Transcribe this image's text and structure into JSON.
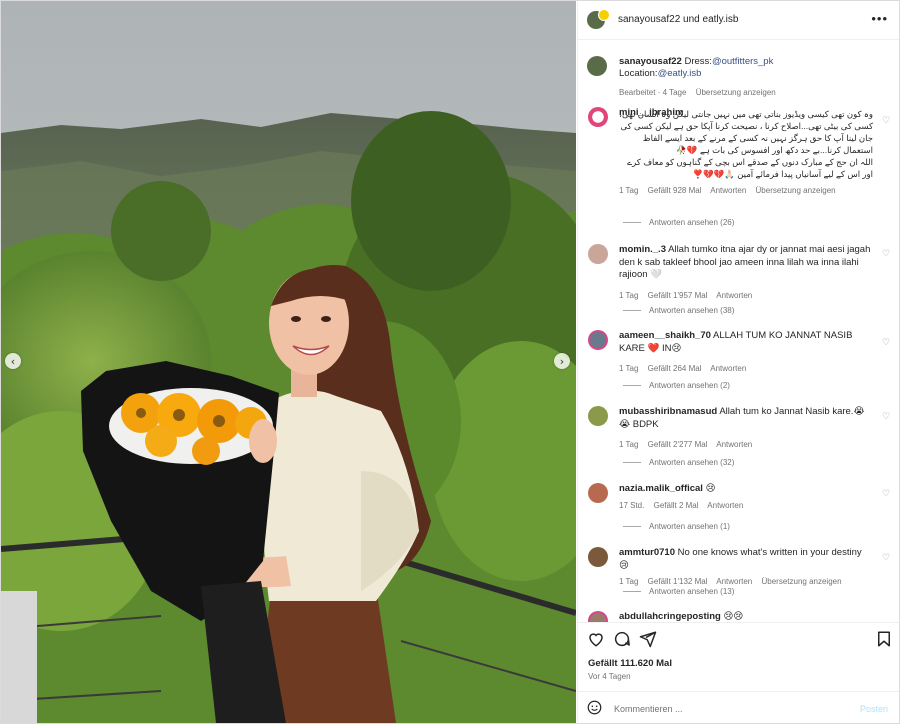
{
  "post": {
    "header_title": "sanayousaf22 und eatly.isb",
    "caption_user": "sanayousaf22",
    "caption_dress_label": "Dress:",
    "caption_dress_link": "@outfitters_pk",
    "caption_location_label": "Location:",
    "caption_location_link": "@eatly.isb",
    "caption_edited": "Bearbeitet · 4 Tage",
    "caption_translate": "Übersetzung anzeigen",
    "likes": "Gefällt 111.620 Mal",
    "posted_ago": "Vor 4 Tagen"
  },
  "comments": [
    {
      "user": "mini__ibrahim",
      "text": "وہ کون تھی کیسی ویڈیوز بناتی تھی میں نہیں جانتی لیکن وہ انسان تھی، کسی کی بیٹی تھی...اصلاح کرنا ، نصیحت کرنا آپکا حق ہے لیکن کسی کی جان لینا آپ کا حق ہرگز نہیں نہ کسی کے مرنے کے بعد ایسے الفاظ استعمال کرنا...بے حد دکھ اور افسوس کی بات ہے 💔🥀",
      "text2": "اللہ ان حج کے مبارک دنوں کے صدقے اس بچی کے گناہوں کو معاف کرے اور اس کے لیے آسانیاں پیدا فرمائے آمین 🙏🏻💔💔❣️",
      "age": "1 Tag",
      "likes": "Gefällt 928 Mal",
      "reply": "Antworten",
      "translate": "Übersetzung anzeigen",
      "replies": "Antworten ansehen (26)"
    },
    {
      "user": "momin._.3",
      "text": "Allah tumko itna ajar dy or jannat mai aesi jagah den k sab takleef bhool jao ameen inna lilah wa inna ilahi rajioon 🤍",
      "age": "1 Tag",
      "likes": "Gefällt 1'957 Mal",
      "reply": "Antworten",
      "replies": "Antworten ansehen (38)"
    },
    {
      "user": "aameen__shaikh_70",
      "text": "ALLAH TUM KO JANNAT NASIB KARE ❤️ IN😢",
      "age": "1 Tag",
      "likes": "Gefällt 264 Mal",
      "reply": "Antworten",
      "replies": "Antworten ansehen (2)"
    },
    {
      "user": "mubasshiribnamasud",
      "text": "Allah tum ko Jannat Nasib kare.😭😭 BDPK",
      "age": "1 Tag",
      "likes": "Gefällt 2'277 Mal",
      "reply": "Antworten",
      "replies": "Antworten ansehen (32)"
    },
    {
      "user": "nazia.malik_offical",
      "text": "😢",
      "age": "17 Std.",
      "likes": "Gefällt 2 Mal",
      "reply": "Antworten",
      "replies": "Antworten ansehen (1)"
    },
    {
      "user": "ammtur0710",
      "text": "No one knows what's written in your destiny 😢",
      "age": "1 Tag",
      "likes": "Gefällt 1'132 Mal",
      "reply": "Antworten",
      "translate": "Übersetzung anzeigen",
      "replies": "Antworten ansehen (13)"
    },
    {
      "user": "abdullahcringeposting",
      "text": "😢😢"
    }
  ],
  "compose": {
    "placeholder": "Kommentieren ...",
    "post_label": "Posten"
  },
  "nav": {
    "prev": "‹",
    "next": "›",
    "more": "•••"
  },
  "icons": [
    "heart-icon",
    "comment-icon",
    "share-icon",
    "bookmark-icon",
    "emoji-icon",
    "more-icon"
  ],
  "colors": {
    "link": "#385185",
    "post_disabled": "#b2dffc",
    "accent_badge": "#f5d000"
  }
}
